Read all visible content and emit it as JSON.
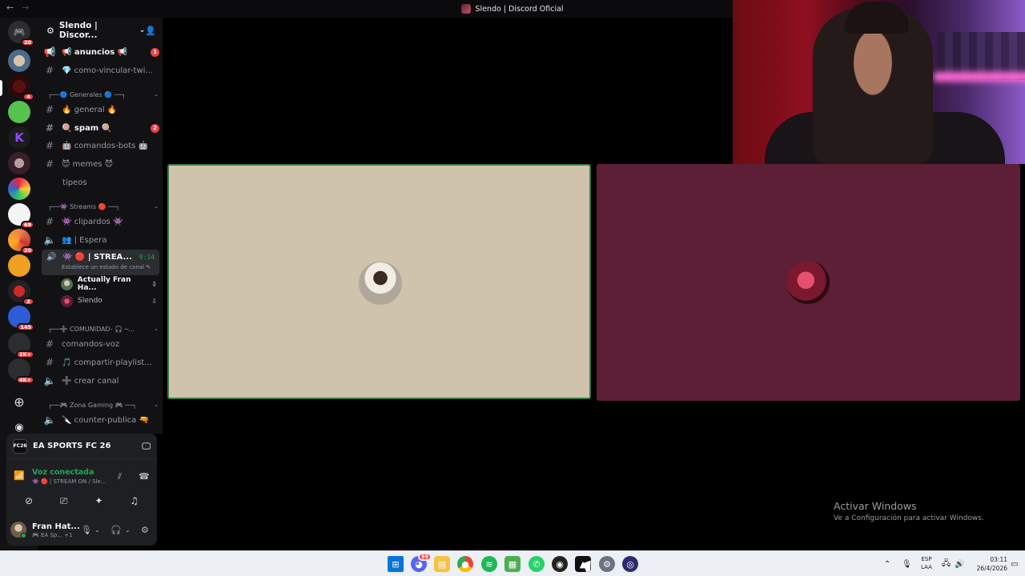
{
  "window": {
    "title": "Slendo | Discord Oficial",
    "back_icon": "←",
    "forward_icon": "→"
  },
  "colors": {
    "accent_green": "#23a55a",
    "badge_red": "#f23f43",
    "tile1_bg": "#cfc3ab",
    "tile2_bg": "#5c1f36"
  },
  "guild_badges": {
    "dm": "20",
    "g2": "4",
    "g3": "69",
    "g4": "20",
    "g5": "2",
    "g6": "145",
    "g7": "2K+",
    "g8": "4K+"
  },
  "server": {
    "name": "Slendo | Discor...",
    "chevron": "⌄"
  },
  "channels": {
    "anuncios": {
      "name": "📢 anuncios 📢",
      "badge": "1"
    },
    "como_vincular": {
      "name": "💎 como-vincular-twi..."
    },
    "cat_generales": {
      "name": "┌──🔵 Generales 🔵 ──┐"
    },
    "general": {
      "name": "🔥 general 🔥"
    },
    "spam": {
      "name": "🍭 spam 🍭",
      "badge": "2"
    },
    "comandos_bots": {
      "name": "🤖 comandos-bots 🤖"
    },
    "memes": {
      "name": "😈 memes 😈"
    },
    "tipeos": {
      "name": "tipeos"
    },
    "cat_streams": {
      "name": "┌──👾 Streams 🔴 ──┐"
    },
    "clipardos": {
      "name": "👾 clipardos 👾"
    },
    "espera": {
      "name": "👥 | Espera"
    },
    "stream_on": {
      "name": "👾 🔴 | STREA...",
      "time": "9:14",
      "status": "Establece un estado de canal ✎"
    },
    "cat_comunidad": {
      "name": "┌──➕ COMUNIDAD- 🎧 ─..."
    },
    "comandos_voz": {
      "name": "comandos-voz"
    },
    "compartir_playlist": {
      "name": "🎵 compartir-playlist..."
    },
    "crear_canal": {
      "name": "➕ crear canal"
    },
    "cat_gaming": {
      "name": "┌──🎮 Zona Gaming 🎮 ──┐"
    },
    "counter": {
      "name": "🔪 counter-publica 🔫"
    }
  },
  "voice_users": [
    {
      "name": "Actually Fran Ha...",
      "live": "⇩"
    },
    {
      "name": "Slendo",
      "live": "⇩"
    }
  ],
  "activity": {
    "game_icon_text": "FC26",
    "title": "EA SPORTS FC 26"
  },
  "voice": {
    "title": "Voz conectada",
    "sub": "👾 🔴 | STREAM ON / Sle..."
  },
  "user": {
    "name": "Fran Hat...",
    "sub": "🎮 EA Sp... +1"
  },
  "watermark": {
    "line1": "Activar Windows",
    "line2": "Ve a Configuración para activar Windows."
  },
  "taskbar": {
    "discord_badge": "99",
    "lang": "ESP",
    "lang2": "LAA",
    "time": "03:11",
    "date": "26/4/2026"
  }
}
